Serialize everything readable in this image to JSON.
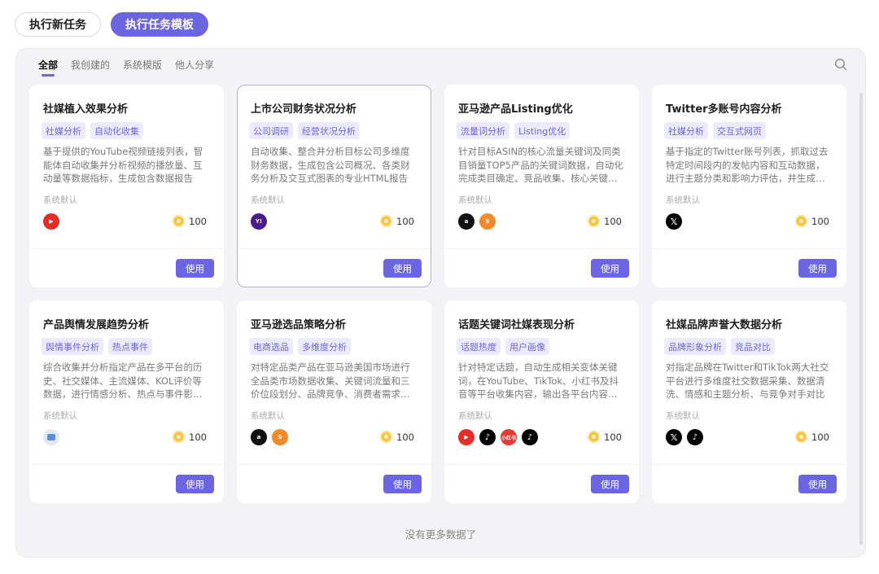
{
  "top_tabs": [
    "执行新任务",
    "执行任务模板"
  ],
  "filters": [
    "全部",
    "我创建的",
    "系统模版",
    "他人分享"
  ],
  "use_label": "使用",
  "no_more": "没有更多数据了",
  "colors": {
    "accent": "#6b66e0",
    "tag_bg": "#eceafd",
    "panel_bg": "#f3f3f5"
  },
  "cards": [
    {
      "title": "社媒植入效果分析",
      "tags": [
        "社媒分析",
        "自动化收集"
      ],
      "desc": "基于提供的YouTube视频链接列表，智能体自动收集并分析视频的播放量、互动量等数据指标，生成包含数据报告",
      "source": "系统默认",
      "platforms": [
        {
          "icon": "youtube-icon",
          "label": "▶"
        }
      ],
      "points": "100"
    },
    {
      "title": "上市公司财务状况分析",
      "tags": [
        "公司调研",
        "经营状况分析"
      ],
      "desc": "自动收集、整合并分析目标公司多维度财务数据，生成包含公司概况、各类财务分析及交互式图表的专业HTML报告",
      "source": "系统默认",
      "platforms": [
        {
          "icon": "yahoo-icon",
          "label": "Y!"
        }
      ],
      "points": "100"
    },
    {
      "title": "亚马逊产品Listing优化",
      "tags": [
        "流量词分析",
        "Listing优化"
      ],
      "desc": "针对目标ASIN的核心流量关键词及同类目销量TOP5产品的关键词数据，自动化完成类目确定、竞品收集、核心关键词分析",
      "source": "系统默认",
      "platforms": [
        {
          "icon": "amazon-icon",
          "label": "a"
        },
        {
          "icon": "sorftime-icon",
          "label": "S"
        }
      ],
      "points": "100"
    },
    {
      "title": "Twitter多账号内容分析",
      "tags": [
        "社媒分析",
        "交互式网页"
      ],
      "desc": "基于指定的Twitter账号列表，抓取过去特定时间段内的发帖内容和互动数据，进行主题分类和影响力评估，并生成报告",
      "source": "系统默认",
      "platforms": [
        {
          "icon": "x-icon",
          "label": "𝕏"
        }
      ],
      "points": "100"
    },
    {
      "title": "产品舆情发展趋势分析",
      "tags": [
        "舆情事件分析",
        "热点事件"
      ],
      "desc": "综合收集并分析指定产品在多平台的历史、社交媒体、主流媒体、KOL评价等数据，进行情感分析、热点与事件影响分析",
      "source": "系统默认",
      "platforms": [
        {
          "icon": "news-icon",
          "label": ""
        }
      ],
      "points": "100"
    },
    {
      "title": "亚马逊选品策略分析",
      "tags": [
        "电商选品",
        "多维度分析"
      ],
      "desc": "对特定品类产品在亚马逊美国市场进行全品类市场数据收集、关键词流量和三价位段划分、品牌竞争、消费者需求分析",
      "source": "系统默认",
      "platforms": [
        {
          "icon": "amazon-icon",
          "label": "a"
        },
        {
          "icon": "sorftime-icon",
          "label": "S"
        }
      ],
      "points": "100"
    },
    {
      "title": "话题关键词社媒表现分析",
      "tags": [
        "话题热度",
        "用户画像"
      ],
      "desc": "针对特定话题，自动生成相关变体关键词，在YouTube、TikTok、小红书及抖音等平台收集内容，输出各平台内容分析报告",
      "source": "系统默认",
      "platforms": [
        {
          "icon": "youtube-icon",
          "label": "▶"
        },
        {
          "icon": "tiktok-icon",
          "label": "♪"
        },
        {
          "icon": "xiaohongshu-icon",
          "label": "小红书"
        },
        {
          "icon": "tiktok-icon",
          "label": "♪"
        }
      ],
      "points": "100"
    },
    {
      "title": "社媒品牌声誉大数据分析",
      "tags": [
        "品牌形象分析",
        "竞品对比"
      ],
      "desc": "对指定品牌在Twitter和TikTok两大社交平台进行多维度社交数据采集、数据清洗、情感和主题分析、与竞争对手对比",
      "source": "系统默认",
      "platforms": [
        {
          "icon": "x-icon",
          "label": "𝕏"
        },
        {
          "icon": "tiktok-icon",
          "label": "♪"
        }
      ],
      "points": "100"
    }
  ]
}
